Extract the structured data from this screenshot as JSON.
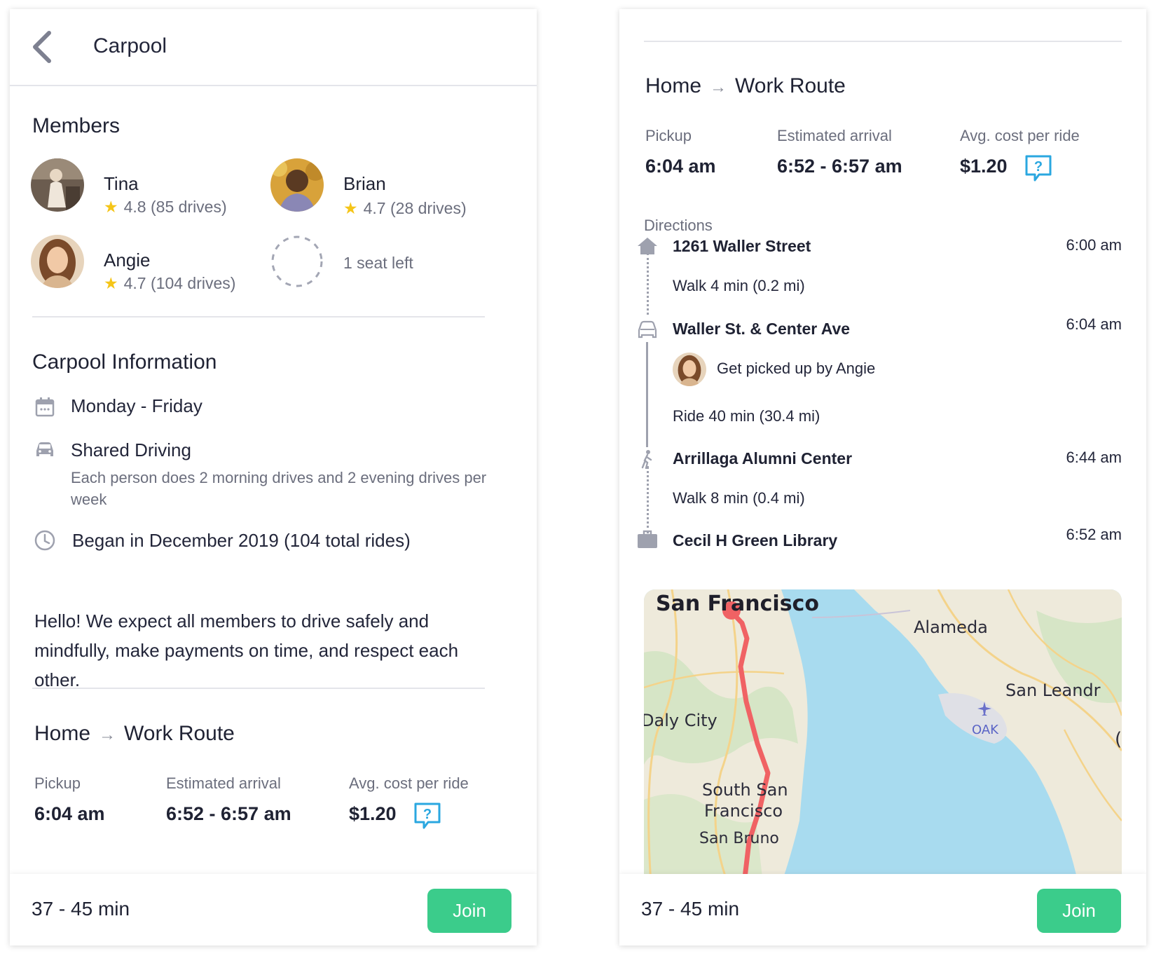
{
  "left": {
    "header": {
      "title": "Carpool"
    },
    "members_title": "Members",
    "members": [
      {
        "name": "Tina",
        "rating": "4.8 (85 drives)"
      },
      {
        "name": "Brian",
        "rating": "4.7 (28 drives)"
      },
      {
        "name": "Angie",
        "rating": "4.7 (104 drives)"
      }
    ],
    "seat_left": "1 seat left",
    "info_title": "Carpool Information",
    "info": {
      "schedule": "Monday - Friday",
      "driving": "Shared Driving",
      "driving_detail": "Each person does 2 morning drives and 2 evening drives per week",
      "began": "Began in December 2019 (104 total rides)"
    },
    "note": "Hello! We expect all members to drive safely and mindfully, make payments on time, and respect each other.",
    "route": {
      "from": "Home",
      "to": "Work Route",
      "pickup_label": "Pickup",
      "pickup": "6:04 am",
      "arrival_label": "Estimated arrival",
      "arrival": "6:52 - 6:57 am",
      "cost_label": "Avg. cost per ride",
      "cost": "$1.20"
    },
    "footer": {
      "duration": "37 - 45 min",
      "join": "Join"
    }
  },
  "right": {
    "route": {
      "from": "Home",
      "to": "Work Route",
      "pickup_label": "Pickup",
      "pickup": "6:04 am",
      "arrival_label": "Estimated arrival",
      "arrival": "6:52 - 6:57 am",
      "cost_label": "Avg. cost per ride",
      "cost": "$1.20"
    },
    "directions_label": "Directions",
    "stops": [
      {
        "name": "1261 Waller Street",
        "time": "6:00 am",
        "icon": "home-icon"
      },
      {
        "name": "Waller St. & Center Ave",
        "time": "6:04 am",
        "icon": "car-icon"
      },
      {
        "name": "Arrillaga Alumni Center",
        "time": "6:44 am",
        "icon": "walk-icon"
      },
      {
        "name": "Cecil H Green Library",
        "time": "6:52 am",
        "icon": "briefcase-icon"
      }
    ],
    "legs": {
      "walk1": "Walk 4 min (0.2 mi)",
      "pickup_by": "Get picked up by Angie",
      "ride": "Ride 40 min (30.4 mi)",
      "walk2": "Walk 8 min (0.4 mi)"
    },
    "map_labels": {
      "sf": "San Francisco",
      "alameda": "Alameda",
      "san_leandro": "San Leandr",
      "daly_city": "Daly City",
      "oak": "OAK",
      "ssf1": "South San",
      "ssf2": "Francisco",
      "san_bruno": "San Bruno"
    },
    "footer": {
      "duration": "37 - 45 min",
      "join": "Join"
    }
  },
  "colors": {
    "accent_green": "#3bcc8b",
    "help_blue": "#2aa7e0",
    "star": "#f5c518",
    "route_red": "#f06264",
    "water": "#a8dbef"
  }
}
